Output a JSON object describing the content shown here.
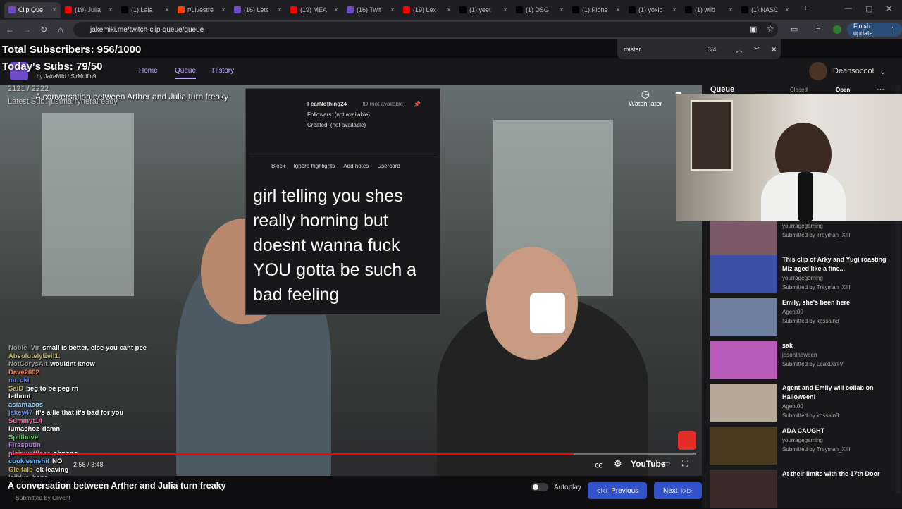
{
  "browser": {
    "tabs": [
      {
        "label": "Clip Que",
        "color": "#6f4acb",
        "active": true
      },
      {
        "label": "(19) Julia",
        "color": "#ff0000"
      },
      {
        "label": "(1) Lala",
        "color": "#000000"
      },
      {
        "label": "r/Livestre",
        "color": "#ff4500"
      },
      {
        "label": "(16) Lets",
        "color": "#6f4acb"
      },
      {
        "label": "(19) MEA",
        "color": "#ff0000"
      },
      {
        "label": "(16) Twit",
        "color": "#6f4acb"
      },
      {
        "label": "(19) Lex",
        "color": "#ff0000"
      },
      {
        "label": "(1) yeet",
        "color": "#000000"
      },
      {
        "label": "(1) DSG",
        "color": "#000000"
      },
      {
        "label": "(1) Pione",
        "color": "#000000"
      },
      {
        "label": "(1) yoxic",
        "color": "#000000"
      },
      {
        "label": "(1) wild",
        "color": "#000000"
      },
      {
        "label": "(1) NASC",
        "color": "#000000"
      }
    ],
    "url": "jakemiki.me/twitch-clip-queue/queue",
    "finish_update": "Finish update",
    "find": {
      "query": "mister",
      "count": "3/4"
    }
  },
  "overlay": {
    "total_subs": "Total Subscribers: 956/1000",
    "today_subs": "Today's Subs: 79/50",
    "ratio": "2121 / 2222",
    "latest_sub": "Latest Sub: justmarryheralready"
  },
  "site": {
    "credits_prefix": "by",
    "credit1": "JakeMiki",
    "credit2": "SirMuffin9",
    "nav": [
      "Home",
      "Queue",
      "History"
    ],
    "user": "Deansocool"
  },
  "video": {
    "title": "A conversation between Arther and Julia turn freaky",
    "watch_later": "Watch later",
    "time": "2:58 / 3:48",
    "progress_fraction": 0.82,
    "youtube_label": "YouTube"
  },
  "popup": {
    "username": "FearNothing24",
    "id": "ID (not available)",
    "followers": "Followers: (not available)",
    "created": "Created: (not available)",
    "actions": [
      "Block",
      "Ignore highlights",
      "Add notes",
      "Usercard"
    ],
    "message": "girl telling you shes really horning but doesnt wanna fuck YOU gotta be such a bad feeling"
  },
  "chat": [
    {
      "user": "Noble_Vir",
      "color": "#9a9a9a",
      "msg": "small is better, else you cant pee"
    },
    {
      "user": "AbsolutelyEvil1:",
      "color": "#c5b358",
      "msg": ""
    },
    {
      "user": "NotCorysAlt",
      "color": "#9a9a9a",
      "msg": "wouldnt know"
    },
    {
      "user": "Dave2092",
      "color": "#ff7f50",
      "msg": ""
    },
    {
      "user": "mrroki",
      "color": "#5b8cff",
      "msg": ""
    },
    {
      "user": "SaiD",
      "color": "#c5b358",
      "msg": "beg to be peg rn"
    },
    {
      "user": "letboot",
      "color": "#ffffff",
      "msg": ""
    },
    {
      "user": "asiantacos",
      "color": "#9ad7ff",
      "msg": ""
    },
    {
      "user": "jakey47",
      "color": "#5b8cff",
      "msg": "it's a lie that it's bad for you"
    },
    {
      "user": "Summyt14",
      "color": "#ff69b4",
      "msg": ""
    },
    {
      "user": "lumachoz",
      "color": "#ffffff",
      "msg": "damn"
    },
    {
      "user": "Spillbuve",
      "color": "#66cc66",
      "msg": ""
    },
    {
      "user": "Firasputin",
      "color": "#c070ff",
      "msg": ""
    },
    {
      "user": "plainwaffleee",
      "color": "#ff69b4",
      "msg": "ohnono"
    },
    {
      "user": "cookiesnshit",
      "color": "#66bbff",
      "msg": "NO"
    },
    {
      "user": "Gleitalb",
      "color": "#c5b358",
      "msg": "ok leaving"
    },
    {
      "user": "isildur_bane",
      "color": "#66cc66",
      "msg": ""
    }
  ],
  "bottom": {
    "title": "A conversation between Arther and Julia turn freaky",
    "submitted": "Submitted by Clivent",
    "autoplay": "Autoplay",
    "previous": "Previous",
    "next": "Next"
  },
  "queue": {
    "heading": "Queue",
    "closed": "Closed",
    "open": "Open",
    "items": [
      {
        "title": "",
        "channel": "yourragegaming",
        "submitter": "Submitted by Treyman_XIII",
        "thumb": "#7a5a66"
      },
      {
        "title": "This clip of Arky and Yugi roasting Miz aged like a fine...",
        "channel": "yourragegaming",
        "submitter": "Submitted by Treyman_XIII",
        "thumb": "#3a4fa6"
      },
      {
        "title": "Emily, she's been here",
        "channel": "Agent00",
        "submitter": "Submitted by kossain8",
        "thumb": "#6f7fa0"
      },
      {
        "title": "sak",
        "channel": "jasontheween",
        "submitter": "Submitted by LeakDaTV",
        "thumb": "#b85ab8"
      },
      {
        "title": "Agent and Emily will collab on Halloween!",
        "channel": "Agent00",
        "submitter": "Submitted by kossain8",
        "thumb": "#b7a99a"
      },
      {
        "title": "ADA CAUGHT",
        "channel": "yourragegaming",
        "submitter": "Submitted by Treyman_XIII",
        "thumb": "#4c3a22"
      },
      {
        "title": "At their limits with the 17th Door",
        "channel": "",
        "submitter": "",
        "thumb": "#3a2a2a"
      }
    ]
  }
}
